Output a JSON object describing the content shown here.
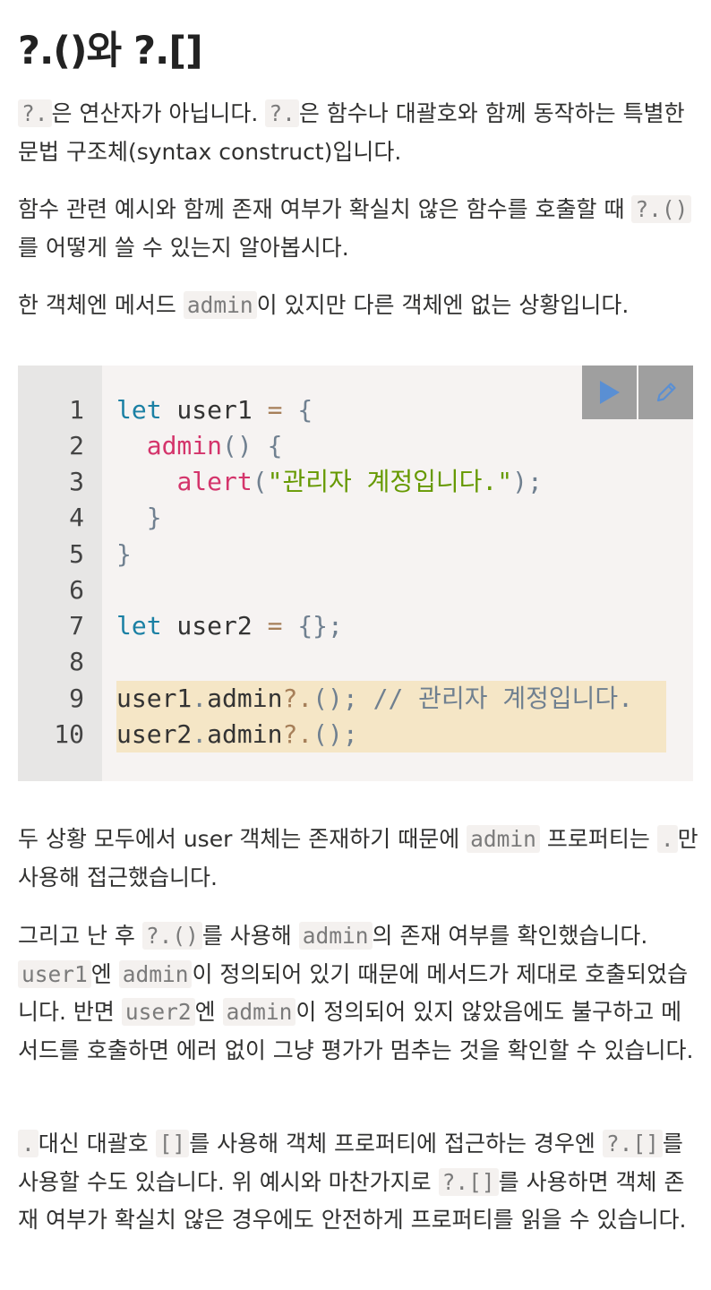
{
  "title": "?.()와 ?.[]",
  "p1": {
    "c1": "?.",
    "t1": "은 연산자가 아닙니다. ",
    "c2": "?.",
    "t2": "은 함수나 대괄호와 함께 동작하는 특별한 문법 구조체(syntax construct)입니다."
  },
  "p2": {
    "t1": "함수 관련 예시와 함께 존재 여부가 확실치 않은 함수를 호출할 때 ",
    "c1": "?.()",
    "t2": "를 어떻게 쓸 수 있는지 알아봅시다."
  },
  "p3": {
    "t1": "한 객체엔 메서드 ",
    "c1": "admin",
    "t2": "이 있지만 다른 객체엔 없는 상황입니다."
  },
  "code": {
    "run_icon": "play-icon",
    "edit_icon": "pencil-icon",
    "line_numbers": [
      "1",
      "2",
      "3",
      "4",
      "5",
      "6",
      "7",
      "8",
      "9",
      "10"
    ],
    "l1": {
      "a": "let",
      "b": " user1 ",
      "c": "=",
      "d": " ",
      "e": "{"
    },
    "l2": {
      "a": "  ",
      "b": "admin",
      "c": "()",
      "d": " ",
      "e": "{"
    },
    "l3": {
      "a": "    ",
      "b": "alert",
      "c": "(",
      "d": "\"관리자 계정입니다.\"",
      "e": ");"
    },
    "l4": {
      "a": "  ",
      "b": "}"
    },
    "l5": {
      "a": "}"
    },
    "l7": {
      "a": "let",
      "b": " user2 ",
      "c": "=",
      "d": " ",
      "e": "{};"
    },
    "l9": {
      "a": "user1",
      "b": ".",
      "c": "admin",
      "d": "?.",
      "e": "();",
      "f": " // 관리자 계정입니다."
    },
    "l10": {
      "a": "user2",
      "b": ".",
      "c": "admin",
      "d": "?.",
      "e": "();"
    }
  },
  "p4": {
    "t1": "두 상황 모두에서 user 객체는 존재하기 때문에 ",
    "c1": "admin",
    "t2": " 프로퍼티는 ",
    "c2": ".",
    "t3": "만 사용해 접근했습니다."
  },
  "p5": {
    "t1": "그리고 난 후 ",
    "c1": "?.()",
    "t2": "를 사용해 ",
    "c2": "admin",
    "t3": "의 존재 여부를 확인했습니다. ",
    "c3": "user1",
    "t4": "엔 ",
    "c4": "admin",
    "t5": "이 정의되어 있기 때문에 메서드가 제대로 호출되었습니다. 반면 ",
    "c5": "user2",
    "t6": "엔 ",
    "c6": "admin",
    "t7": "이 정의되어 있지 않았음에도 불구하고 메서드를 호출하면 에러 없이 그냥 평가가 멈추는 것을 확인할 수 있습니다."
  },
  "p6": {
    "c1": ".",
    "t1": "대신 대괄호 ",
    "c2": "[]",
    "t2": "를 사용해 객체 프로퍼티에 접근하는 경우엔 ",
    "c3": "?.[]",
    "t3": "를 사용할 수도 있습니다. 위 예시와 마찬가지로 ",
    "c4": "?.[]",
    "t4": "를 사용하면 객체 존재 여부가 확실치 않은 경우에도 안전하게 프로퍼티를 읽을 수 있습니다."
  }
}
